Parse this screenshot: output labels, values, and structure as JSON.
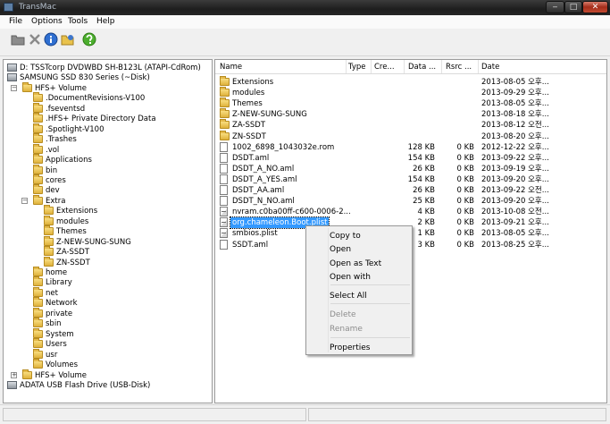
{
  "window": {
    "title": "TransMac"
  },
  "menu": [
    "File",
    "Options",
    "Tools",
    "Help"
  ],
  "toolbar_icons": [
    "folder-icon",
    "delete-icon",
    "info-icon",
    "open-folder-icon",
    "help-icon"
  ],
  "tree": [
    {
      "label": "D: TSSTcorp DVDWBD SH-B123L (ATAPI-CdRom)",
      "icon": "drive-icon",
      "level": 0,
      "expander": ""
    },
    {
      "label": "SAMSUNG SSD 830 Series (~Disk)",
      "icon": "drive-icon",
      "level": 0,
      "expander": ""
    },
    {
      "label": "HFS+ Volume",
      "icon": "folder-icon",
      "level": 1,
      "expander": "−"
    },
    {
      "label": ".DocumentRevisions-V100",
      "icon": "folder-icon",
      "level": 2,
      "expander": ""
    },
    {
      "label": ".fseventsd",
      "icon": "folder-icon",
      "level": 2,
      "expander": ""
    },
    {
      "label": ".HFS+ Private Directory Data",
      "icon": "folder-icon",
      "level": 2,
      "expander": ""
    },
    {
      "label": ".Spotlight-V100",
      "icon": "folder-icon",
      "level": 2,
      "expander": ""
    },
    {
      "label": ".Trashes",
      "icon": "folder-icon",
      "level": 2,
      "expander": ""
    },
    {
      "label": ".vol",
      "icon": "folder-icon",
      "level": 2,
      "expander": ""
    },
    {
      "label": "Applications",
      "icon": "folder-icon",
      "level": 2,
      "expander": ""
    },
    {
      "label": "bin",
      "icon": "folder-icon",
      "level": 2,
      "expander": ""
    },
    {
      "label": "cores",
      "icon": "folder-icon",
      "level": 2,
      "expander": ""
    },
    {
      "label": "dev",
      "icon": "folder-icon",
      "level": 2,
      "expander": ""
    },
    {
      "label": "Extra",
      "icon": "folder-icon",
      "level": 2,
      "expander": "−"
    },
    {
      "label": "Extensions",
      "icon": "folder-icon",
      "level": 3,
      "expander": ""
    },
    {
      "label": "modules",
      "icon": "folder-icon",
      "level": 3,
      "expander": ""
    },
    {
      "label": "Themes",
      "icon": "folder-icon",
      "level": 3,
      "expander": ""
    },
    {
      "label": "Z-NEW-SUNG-SUNG",
      "icon": "folder-icon",
      "level": 3,
      "expander": ""
    },
    {
      "label": "ZA-SSDT",
      "icon": "folder-icon",
      "level": 3,
      "expander": ""
    },
    {
      "label": "ZN-SSDT",
      "icon": "folder-icon",
      "level": 3,
      "expander": ""
    },
    {
      "label": "home",
      "icon": "folder-icon",
      "level": 2,
      "expander": ""
    },
    {
      "label": "Library",
      "icon": "folder-icon",
      "level": 2,
      "expander": ""
    },
    {
      "label": "net",
      "icon": "folder-icon",
      "level": 2,
      "expander": ""
    },
    {
      "label": "Network",
      "icon": "folder-icon",
      "level": 2,
      "expander": ""
    },
    {
      "label": "private",
      "icon": "folder-icon",
      "level": 2,
      "expander": ""
    },
    {
      "label": "sbin",
      "icon": "folder-icon",
      "level": 2,
      "expander": ""
    },
    {
      "label": "System",
      "icon": "folder-icon",
      "level": 2,
      "expander": ""
    },
    {
      "label": "Users",
      "icon": "folder-icon",
      "level": 2,
      "expander": ""
    },
    {
      "label": "usr",
      "icon": "folder-icon",
      "level": 2,
      "expander": ""
    },
    {
      "label": "Volumes",
      "icon": "folder-icon",
      "level": 2,
      "expander": ""
    },
    {
      "label": "HFS+ Volume",
      "icon": "folder-icon",
      "level": 1,
      "expander": "+"
    },
    {
      "label": "ADATA USB Flash Drive (USB-Disk)",
      "icon": "drive-icon",
      "level": 0,
      "expander": ""
    }
  ],
  "list": {
    "columns": [
      "Name",
      "Type",
      "Cre...",
      "Data ...",
      "Rsrc ...",
      "Date"
    ],
    "rows": [
      {
        "name": "Extensions",
        "icon": "folder-icon",
        "data": "",
        "rsrc": "",
        "date": "2013-08-05 오후..."
      },
      {
        "name": "modules",
        "icon": "folder-icon",
        "data": "",
        "rsrc": "",
        "date": "2013-09-29 오후..."
      },
      {
        "name": "Themes",
        "icon": "folder-icon",
        "data": "",
        "rsrc": "",
        "date": "2013-08-05 오후..."
      },
      {
        "name": "Z-NEW-SUNG-SUNG",
        "icon": "folder-icon",
        "data": "",
        "rsrc": "",
        "date": "2013-08-18 오후..."
      },
      {
        "name": "ZA-SSDT",
        "icon": "folder-icon",
        "data": "",
        "rsrc": "",
        "date": "2013-08-12 오전..."
      },
      {
        "name": "ZN-SSDT",
        "icon": "folder-icon",
        "data": "",
        "rsrc": "",
        "date": "2013-08-20 오후..."
      },
      {
        "name": "1002_6898_1043032e.rom",
        "icon": "file-icon",
        "data": "128 KB",
        "rsrc": "0 KB",
        "date": "2012-12-22 오후..."
      },
      {
        "name": "DSDT.aml",
        "icon": "file-icon",
        "data": "154 KB",
        "rsrc": "0 KB",
        "date": "2013-09-22 오후..."
      },
      {
        "name": "DSDT_A_NO.aml",
        "icon": "file-icon",
        "data": "26 KB",
        "rsrc": "0 KB",
        "date": "2013-09-19 오후..."
      },
      {
        "name": "DSDT_A_YES.aml",
        "icon": "file-icon",
        "data": "154 KB",
        "rsrc": "0 KB",
        "date": "2013-09-20 오후..."
      },
      {
        "name": "DSDT_AA.aml",
        "icon": "file-icon",
        "data": "26 KB",
        "rsrc": "0 KB",
        "date": "2013-09-22 오전..."
      },
      {
        "name": "DSDT_N_NO.aml",
        "icon": "file-icon",
        "data": "25 KB",
        "rsrc": "0 KB",
        "date": "2013-09-20 오후..."
      },
      {
        "name": "nvram.c0ba00ff-c600-0006-2...",
        "icon": "plist-icon",
        "data": "4 KB",
        "rsrc": "0 KB",
        "date": "2013-10-08 오전..."
      },
      {
        "name": "org.chameleon.Boot.plist",
        "icon": "plist-icon",
        "data": "2 KB",
        "rsrc": "0 KB",
        "date": "2013-09-21 오후...",
        "selected": true
      },
      {
        "name": "smbios.plist",
        "icon": "plist-icon",
        "data": "1 KB",
        "rsrc": "0 KB",
        "date": "2013-08-05 오후..."
      },
      {
        "name": "SSDT.aml",
        "icon": "file-icon",
        "data": "3 KB",
        "rsrc": "0 KB",
        "date": "2013-08-25 오후..."
      }
    ]
  },
  "context_menu": [
    {
      "label": "Copy to",
      "enabled": true
    },
    {
      "label": "Open",
      "enabled": true
    },
    {
      "label": "Open as Text",
      "enabled": true
    },
    {
      "label": "Open with",
      "enabled": true
    },
    {
      "separator": true
    },
    {
      "label": "Select All",
      "enabled": true
    },
    {
      "separator": true
    },
    {
      "label": "Delete",
      "enabled": false
    },
    {
      "label": "Rename",
      "enabled": false
    },
    {
      "separator": true
    },
    {
      "label": "Properties",
      "enabled": true
    }
  ],
  "window_buttons": {
    "minimize": "‒",
    "maximize": "□",
    "close": "✕"
  }
}
